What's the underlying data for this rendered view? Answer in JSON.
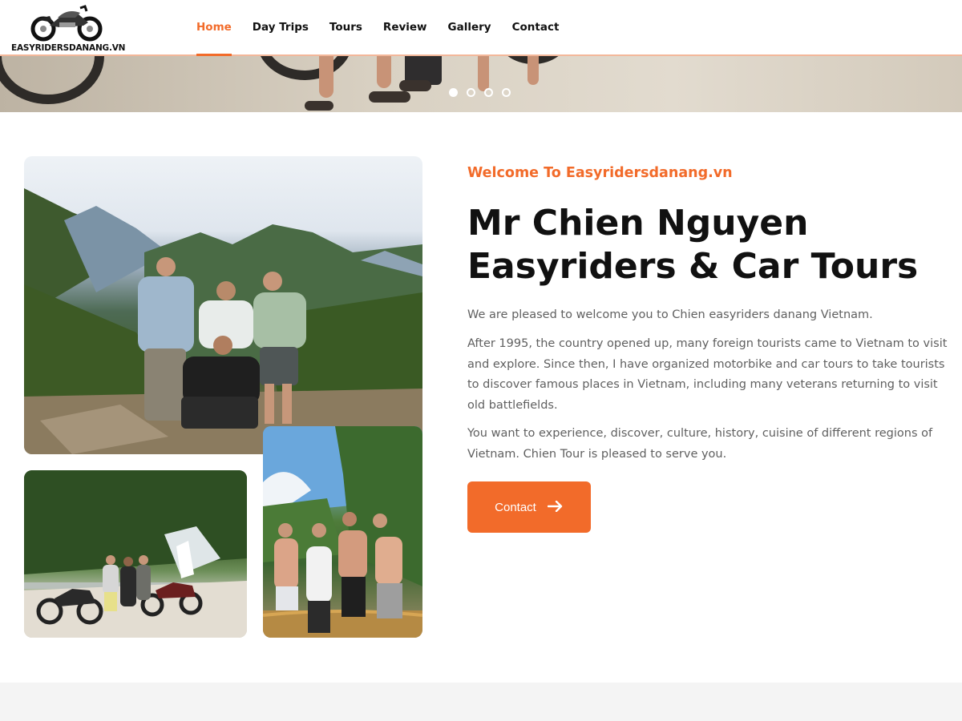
{
  "brand": {
    "logo_text": "EASYRIDERSDANANG.VN",
    "accent": "#f26b2a"
  },
  "nav": {
    "items": [
      {
        "label": "Home",
        "active": true
      },
      {
        "label": "Day Trips"
      },
      {
        "label": "Tours"
      },
      {
        "label": "Review"
      },
      {
        "label": "Gallery"
      },
      {
        "label": "Contact"
      }
    ]
  },
  "slider": {
    "slide_count": 4,
    "active_index": 0
  },
  "about": {
    "kicker": "Welcome To Easyridersdanang.vn",
    "title": "Mr Chien Nguyen Easyriders & Car Tours",
    "paragraphs": [
      "We are pleased to welcome you to Chien easyriders danang Vietnam.",
      "After 1995, the country opened up, many foreign tourists came to Vietnam to visit and explore. Since then, I have organized motorbike and car tours to take tourists to discover famous places in Vietnam, including many veterans returning to visit old battlefields.",
      "You want to experience, discover, culture, history, cuisine of different regions of Vietnam. Chien Tour is pleased to serve you."
    ],
    "cta_label": "Contact",
    "cta_icon": "arrow-right-icon"
  }
}
